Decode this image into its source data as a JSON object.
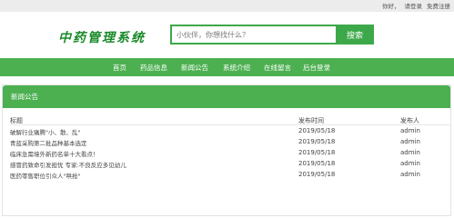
{
  "topbar": {
    "greeting": "你好，",
    "login": "请登录",
    "register": "免费注册"
  },
  "logo": {
    "text": "中药管理系统"
  },
  "search": {
    "placeholder": "小伙伴，你想找什么？",
    "button_label": "搜索"
  },
  "nav": {
    "items": [
      {
        "label": "首页"
      },
      {
        "label": "药品信息"
      },
      {
        "label": "新闻公告"
      },
      {
        "label": "系统介绍"
      },
      {
        "label": "在线留言"
      },
      {
        "label": "后台登录"
      }
    ]
  },
  "news": {
    "title": "新闻公告",
    "columns": {
      "title": "标题",
      "date": "发布时间",
      "author": "发布人"
    },
    "rows": [
      {
        "title": "破解行业痛腾\"小、散、乱\"",
        "date": "2019/05/18",
        "author": "admin"
      },
      {
        "title": "青蓝采购第二批品种基本选定",
        "date": "2019/05/18",
        "author": "admin"
      },
      {
        "title": "临床急需境外新药名单十大看点！",
        "date": "2019/05/18",
        "author": "admin"
      },
      {
        "title": "感冒药致命引发担忧 专家:不良反应多见幼儿",
        "date": "2019/05/18",
        "author": "admin"
      },
      {
        "title": "医药零售职位引众人\"哄抢\"",
        "date": "2019/05/18",
        "author": "admin"
      }
    ]
  }
}
